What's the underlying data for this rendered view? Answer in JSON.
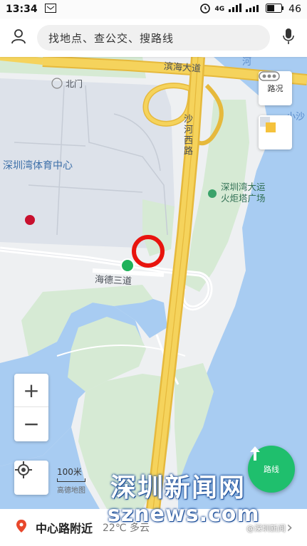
{
  "status": {
    "time": "13:34",
    "network": "4G",
    "battery": "46"
  },
  "search": {
    "placeholder": "找地点、查公交、搜路线"
  },
  "map": {
    "labels": {
      "binhai": "滨海大道",
      "beimen": "北门",
      "shahexi": "沙河西路",
      "stadium": "深圳湾体育中心",
      "torch_line1": "深圳湾大运",
      "torch_line2": "火炬塔广场",
      "haide": "海德三道",
      "xiaosha": "小沙",
      "he": "河"
    },
    "colors": {
      "water": "#a8ccf2",
      "park": "#d6ead4",
      "road_main": "#f5d35c",
      "road_edge": "#e6b93c",
      "marker": "#e8140e",
      "poi": "#1fb25a"
    }
  },
  "controls": {
    "traffic_label": "路况",
    "zoom_in": "+",
    "zoom_out": "−",
    "scale_label": "100米",
    "scale_brand": "高德地图",
    "route_label": "路线"
  },
  "bottom": {
    "location": "中心路附近",
    "weather": "22℃ 多云"
  },
  "watermark": {
    "cn": "深圳新闻网",
    "en": "sznews.com",
    "weibo": "@深圳新闻"
  }
}
